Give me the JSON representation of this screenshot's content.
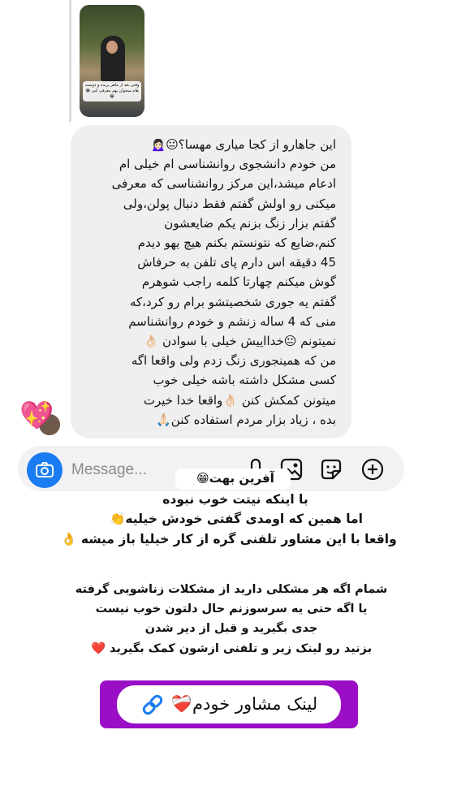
{
  "story_reply": {
    "caption": "وقتی بعد از ماهر بریده و دوست هام میخوان بهم معرفی کنن 😂😂"
  },
  "message": {
    "text": "این جاهارو از کجا میاری مهسا؟😐🙍🏻‍♀️\nمن خودم دانشجوی روانشناسی ام خیلی ام\nادعام میشد،این مرکز روانشناسی که معرفی\nمیکنی رو اولش گفتم فقط دنبال پولن،ولی\nگفتم بزار زنگ بزنم یکم ضایعشون\nکنم،ضایع که نتونستم بکنم هیچ  یهو دیدم\n45 دقیقه اس دارم پای تلفن به حرفاش\nگوش میکنم چهارتا کلمه راجب شوهرم\nگفتم یه جوری شخصیتشو برام رو کرد،که\nمنی که 4 ساله زنشم و خودم روانشناسم\nنمیتونم 😐خدااییش خیلی با سوادن 👌🏻\nمن که همینجوری زنگ زدم ولی واقعا اگه\nکسی مشکل داشته باشه خیلی خوب\nمیتونن کمکش کنن 👌🏻واقعا خدا خیرت\nبده ، زیاد بزار مردم استفاده کنن🙏🏻"
  },
  "composer": {
    "placeholder": "Message...",
    "icons": [
      "camera-icon",
      "microphone-icon",
      "gallery-icon",
      "sticker-icon",
      "plus-icon"
    ],
    "accent": "#1a7cf2"
  },
  "overlay": {
    "line1": "آفرین بهت😁",
    "line2": "با اینکه نیتت خوب نبوده",
    "line3": "اما همین که اومدی گفتی خودش خیلیه👏",
    "line4": "واقعا با این مشاور تلفنی گره از کار خیلیا باز میشه 👌",
    "para1": "شمام اگه هر مشکلی دارید از مشکلات زناشویی گرفته",
    "para2": "یا اگه حتی یه سرسوزنم حال دلتون خوب نیست",
    "para3": "جدی بگیرید و قبل از دیر شدن",
    "para4": "بزنید رو لینک زیر و تلفنی ازشون کمک بگیرید ❤️"
  },
  "link_sticker": {
    "label": "لینک مشاور خودم❤️‍🩹",
    "border_color": "#9a0fc6"
  }
}
